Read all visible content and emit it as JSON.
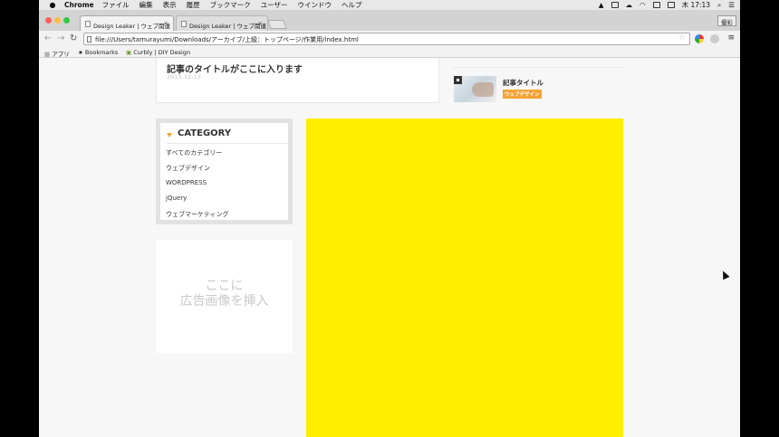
{
  "menubar": {
    "app": "Chrome",
    "items": [
      "ファイル",
      "編集",
      "表示",
      "履歴",
      "ブックマーク",
      "ユーザー",
      "ウインドウ",
      "ヘルプ"
    ],
    "clock": "木 17:13"
  },
  "tabs": [
    {
      "title": "Design Leaker | ウェブ関連",
      "close": "×"
    },
    {
      "title": "Design Leaker | ウェブ関連",
      "close": "×"
    }
  ],
  "profile_label": "優彩",
  "address": "file:///Users/tamurayumi/Downloads/アーカイブ/上級：トップページ/作業用/index.html",
  "bookmarks": [
    "アプリ",
    "Bookmarks",
    "Curbly | DIY Design"
  ],
  "post": {
    "title": "記事のタイトルがここに入ります",
    "date": "2015.12.13"
  },
  "sidebar_post": {
    "title": "記事タイトル",
    "tag": "ウェブデザイン"
  },
  "category": {
    "title": "CATEGORY",
    "items": [
      "すべてのカテゴリー",
      "ウェブデザイン",
      "WORDPRESS",
      "jQuery",
      "ウェブマーケティング"
    ]
  },
  "ad": {
    "line1": "ここに",
    "line2": "広告画像を挿入"
  },
  "colors": {
    "accent": "#f4a233",
    "highlight": "#ffee00"
  }
}
